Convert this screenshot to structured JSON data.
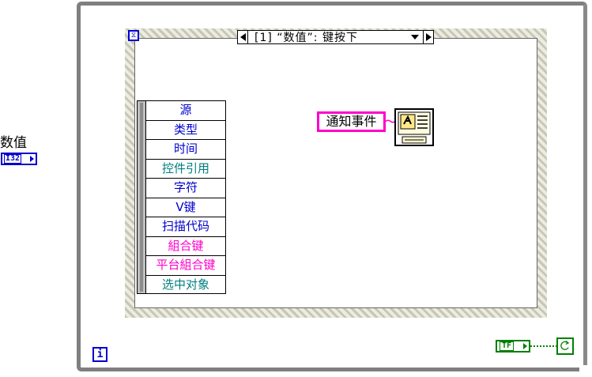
{
  "control": {
    "label": "数值",
    "type_text": "I32"
  },
  "event_structure": {
    "case_label": "[1] “数值”: 键按下",
    "event_data_items": [
      {
        "label": "源",
        "color": "#0000cc"
      },
      {
        "label": "类型",
        "color": "#0000cc"
      },
      {
        "label": "时间",
        "color": "#0000cc"
      },
      {
        "label": "控件引用",
        "color": "#007f7f"
      },
      {
        "label": "字符",
        "color": "#0000cc"
      },
      {
        "label": "V键",
        "color": "#0000cc"
      },
      {
        "label": "扫描代码",
        "color": "#0000cc"
      },
      {
        "label": "組合键",
        "color": "#ff00cc"
      },
      {
        "label": "平台組合键",
        "color": "#ff00cc"
      },
      {
        "label": "选中对象",
        "color": "#007f7f"
      }
    ]
  },
  "notify": {
    "label": "通知事件"
  },
  "loop": {
    "iteration_label": "i"
  },
  "bool_constant": {
    "text": "TF"
  },
  "icons": {
    "timeout": "hourglass-icon",
    "generate_event": "generate-user-event-icon",
    "stop": "stop-condition-icon"
  }
}
